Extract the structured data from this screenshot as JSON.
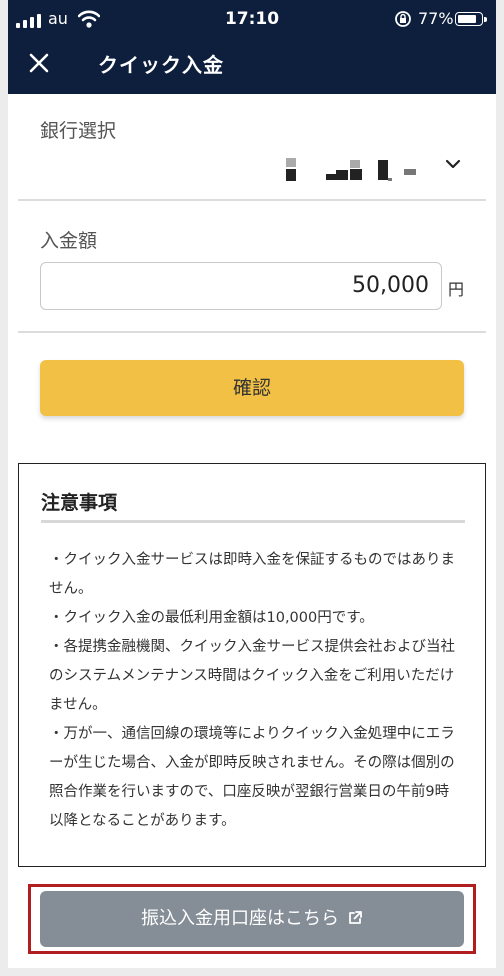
{
  "status_bar": {
    "carrier": "au",
    "time": "17:10",
    "battery": "77%",
    "battery_level": 0.77
  },
  "header": {
    "title": "クイック入金",
    "close_icon": "close-icon"
  },
  "bank_section": {
    "label": "銀行選択",
    "selected_bank": "[redacted]",
    "dropdown_icon": "chevron-down-icon"
  },
  "amount_section": {
    "label": "入金額",
    "value": "50,000",
    "unit": "円"
  },
  "confirm_button": "確認",
  "notice": {
    "title": "注意事項",
    "items": [
      "・クイック入金サービスは即時入金を保証するものではありません。",
      "・クイック入金の最低利用金額は10,000円です。",
      "・各提携金融機関、クイック入金サービス提供会社および当社のシステムメンテナンス時間はクイック入金をご利用いただけません。",
      "・万が一、通信回線の環境等によりクイック入金処理中にエラーが生じた場合、入金が即時反映されません。その際は個別の照合作業を行いますので、口座反映が翌銀行営業日の午前9時以降となることがあります。"
    ]
  },
  "transfer_button": {
    "label": "振込入金用口座はこちら",
    "icon": "external-link-icon"
  },
  "colors": {
    "header_bg": "#0d1f3c",
    "confirm_bg": "#f2c045",
    "transfer_bg": "#858d97",
    "highlight_border": "#b01e20"
  }
}
